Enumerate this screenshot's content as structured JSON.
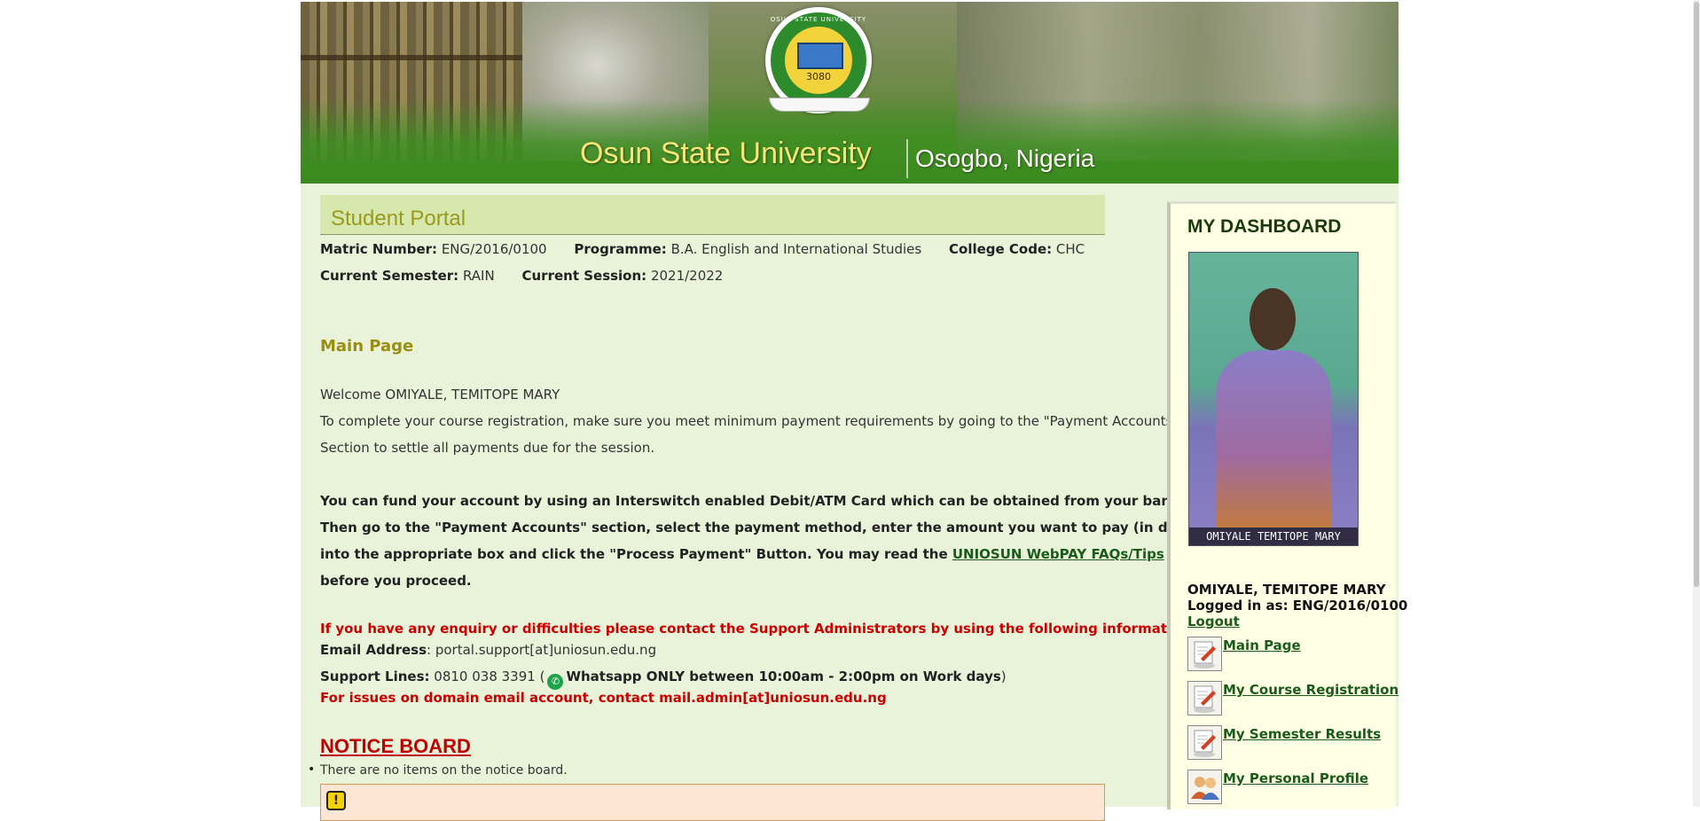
{
  "banner": {
    "university_name": "Osun State University",
    "location": "Osogbo, Nigeria",
    "seal_number": "3080",
    "seal_text": "OSUN STATE UNIVERSITY"
  },
  "portal": {
    "title": "Student Portal",
    "matric_label": "Matric Number:",
    "matric_value": "ENG/2016/0100",
    "programme_label": "Programme:",
    "programme_value": "B.A. English and International Studies",
    "college_label": "College Code:",
    "college_value": "CHC",
    "semester_label": "Current Semester:",
    "semester_value": "RAIN",
    "session_label": "Current Session:",
    "session_value": "2021/2022"
  },
  "main": {
    "page_title": "Main Page",
    "welcome": "Welcome OMIYALE, TEMITOPE MARY",
    "intro_line1": "To complete your course registration, make sure you meet minimum payment requirements by going to the \"Payment Accounts\"",
    "intro_line2": "Section to settle all payments due for the session.",
    "fund_line1": "You can fund your account by using an Interswitch enabled Debit/ATM Card which can be obtained from your bank.",
    "fund_line2": "Then go to the \"Payment Accounts\" section, select the payment method, enter the amount you want to pay (in digits)",
    "fund_line3": "into the appropriate box and click the \"Process Payment\" Button. You may read the ",
    "faq_link": "UNIOSUN WebPAY FAQs/Tips",
    "fund_line4": "before you proceed.",
    "enquiry": "If you have any enquiry or difficulties please contact the Support Administrators by using the following information:",
    "email_label": "Email Address",
    "email_value": ": portal.support[at]uniosun.edu.ng",
    "support_label": "Support Lines:",
    "support_value": " 0810 038 3391 (",
    "whatsapp_text": "Whatsapp ONLY between 10:00am - 2:00pm on Work days",
    "support_close": ")",
    "domain_issue": "For issues on domain email account, contact mail.admin[at]uniosun.edu.ng"
  },
  "notice": {
    "title": "NOTICE BOARD",
    "empty_text": "There are no items on the notice board.",
    "warn_icon": "!"
  },
  "sidebar": {
    "title": "MY DASHBOARD",
    "photo_caption": "OMIYALE TEMITOPE MARY",
    "user_name": "OMIYALE, TEMITOPE MARY",
    "logged_in_as": "Logged in as: ENG/2016/0100",
    "logout": "Logout",
    "menu": [
      {
        "label": "Main Page",
        "icon": "edit-document-icon"
      },
      {
        "label": "My Course Registration",
        "icon": "edit-document-icon"
      },
      {
        "label": "My Semester Results",
        "icon": "edit-document-icon"
      },
      {
        "label": "My Personal Profile",
        "icon": "users-icon"
      }
    ]
  }
}
